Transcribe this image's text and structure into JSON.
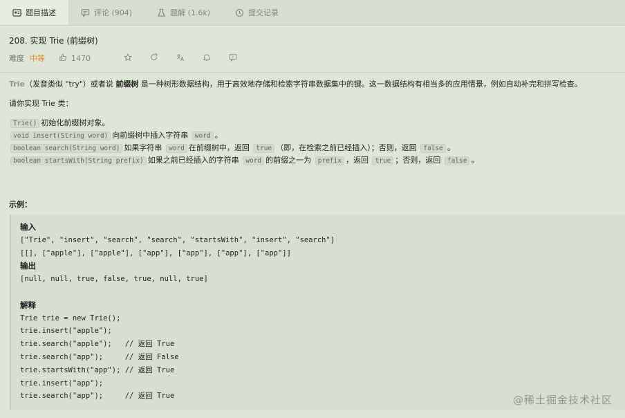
{
  "tabs": [
    {
      "label": "题目描述",
      "icon": "description-icon"
    },
    {
      "label": "评论 (904)",
      "icon": "comment-icon"
    },
    {
      "label": "题解 (1.6k)",
      "icon": "flask-icon"
    },
    {
      "label": "提交记录",
      "icon": "clock-icon"
    }
  ],
  "problem": {
    "title": "208. 实现 Trie (前缀树)",
    "difficulty_label": "难度",
    "difficulty": "中等",
    "likes": "1470"
  },
  "description": {
    "p1_word": "Trie",
    "p1_a": "（发音类似 \"try\"）或者说",
    "p1_bold": "前缀树",
    "p1_b": "是一种树形数据结构，用于高效地存储和检索字符串数据集中的键。这一数据结构有相当多的应用情景，例如自动补完和拼写检查。",
    "p2": "请你实现 Trie 类：",
    "api": {
      "r1_code": "Trie()",
      "r1_text": "初始化前缀树对象。",
      "r2_code": "void insert(String word)",
      "r2_text": "向前缀树中插入字符串",
      "r2_code2": "word",
      "r2_end": "。",
      "r3_code": "boolean search(String word)",
      "r3_text": "如果字符串",
      "r3_code2": "word",
      "r3_text2": "在前缀树中，返回",
      "r3_code3": "true",
      "r3_text3": "（即，在检索之前已经插入）；否则，返回",
      "r3_code4": "false",
      "r3_end": "。",
      "r4_code": "boolean startsWith(String prefix)",
      "r4_text": "如果之前已经插入的字符串",
      "r4_code2": "word",
      "r4_text2": "的前缀之一为",
      "r4_code3": "prefix",
      "r4_text3": "，返回",
      "r4_code4": "true",
      "r4_text4": "；否则，返回",
      "r4_code5": "false",
      "r4_end": "。"
    },
    "example_title": "示例："
  },
  "example": {
    "lines": [
      "输入",
      "[\"Trie\", \"insert\", \"search\", \"search\", \"startsWith\", \"insert\", \"search\"]",
      "[[], [\"apple\"], [\"apple\"], [\"app\"], [\"app\"], [\"app\"], [\"app\"]]",
      "输出",
      "[null, null, true, false, true, null, true]",
      "",
      "解释",
      "Trie trie = new Trie();",
      "trie.insert(\"apple\");",
      "trie.search(\"apple\");   // 返回 True",
      "trie.search(\"app\");     // 返回 False",
      "trie.startsWith(\"app\"); // 返回 True",
      "trie.insert(\"app\");",
      "trie.search(\"app\");     // 返回 True"
    ]
  },
  "watermark": "@稀土掘金技术社区"
}
